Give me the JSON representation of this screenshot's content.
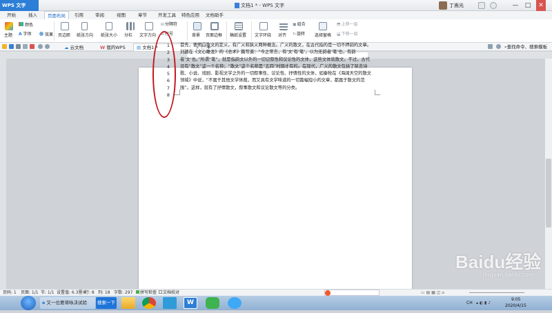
{
  "window": {
    "app_badge": "WPS 文字",
    "title": "文档1 * - WPS 文字",
    "user": "丁嵩光",
    "controls": [
      "—",
      "□",
      "✕"
    ]
  },
  "menu": {
    "tabs": [
      "开始",
      "插入",
      "页面布局",
      "引用",
      "审阅",
      "视图",
      "章节",
      "开发工具",
      "特色应用",
      "文档助手"
    ],
    "active": "页面布局"
  },
  "ribbon": {
    "theme": "主题",
    "colors": "颜色",
    "fonts": "字体",
    "effects": "效果",
    "margins": "页边距",
    "orientation": "纸张方向",
    "size": "纸张大小",
    "columns": "分栏",
    "text_direction": "文字方向",
    "breaks": "分隔符",
    "line_numbers": "行号",
    "background": "背景",
    "page_border": "页面边框",
    "draft_paper": "稿纸设置",
    "wrap": "文字环绕",
    "align": "对齐",
    "group": "组合",
    "rotate": "旋转",
    "selection_pane": "选择窗格",
    "bring_forward": "上移一层",
    "send_backward": "下移一层"
  },
  "tabs": {
    "items": [
      "云文档",
      "我的WPS",
      "文档1 *"
    ],
    "active_index": 2,
    "add": "+",
    "search": "查找命令、搜索模板"
  },
  "document": {
    "line_numbers": [
      "1",
      "2",
      "3",
      "4",
      "5",
      "6",
      "7",
      "8"
    ],
    "text": "首先，要明白散文的定义，有广义和狭义两种概念。广义的散文，在古代指的是一切不押韵的文章。刘勰在《文心雕龙》的《总术》篇写道：“今之常言，有‘文’有‘笔’，以为无韵者‘笔’也，有韵者‘文’也。”所谓“笔”，就是指韵文以外的一切记叙性和议论性的文体，这些文体就散文。不过，古代没有“散文”这一个名称；“散文”这个名称是“五四”时期才有的。在现代，广义的散文包括了除去诗歌、小说、戏剧、影视文学之外的一切叙事性、议论性、抒情性的文体，如秦牧在《海阔天空的散文领域》中说，“不属于其他文学体裁，而又具有文学味道的一切篇幅短小的文章，都属于散文的范围”。这样，就有了抒情散文，叙事散文和议论散文等的分类。"
  },
  "status": {
    "page_num": "页码: 1",
    "pages": "页面: 1/1",
    "section": "节: 1/1",
    "setting": "设置值: 6.3厘米",
    "row": "行: 8",
    "col": "列: 18",
    "words": "字数: 297",
    "spell": "拼写检查",
    "proof": "文档校对"
  },
  "taskbar": {
    "ie_task": "又一位要将咏决试验",
    "search_task": "搜索一下",
    "lang": "CH",
    "time": "9:05",
    "date": "2020/4/15"
  },
  "watermark": {
    "brand": "Baidu经验",
    "url": "jingyan.baidu.com"
  },
  "colors": {
    "accent": "#2d7ed6",
    "annotation_red": "#c0191f"
  }
}
